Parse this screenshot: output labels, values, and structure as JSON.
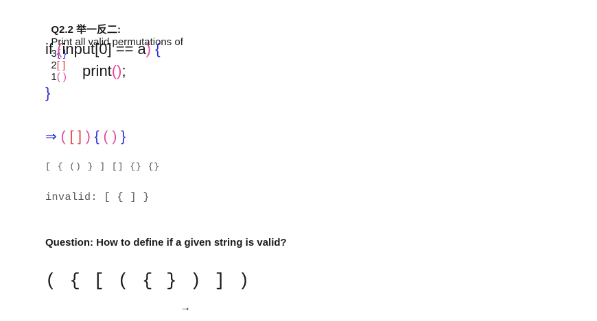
{
  "heading": {
    "qid": "Q2.2 举一反二:",
    "prompt": "Print all valid permutations of",
    "n3": "3",
    "curly": "{ }",
    "n2": "2",
    "square": "[ ]",
    "n1": "1",
    "paren": "( )"
  },
  "code": {
    "kw_if": "if",
    "open_paren": "(",
    "cond_a": "input[0] == a",
    "close_paren": ")",
    "open_brace": "{",
    "call": "print",
    "call_parens": "()",
    "semicolon": ";",
    "close_brace": "}"
  },
  "result": {
    "arrow": "⇒",
    "open_paren": "(",
    "square": "[ ]",
    "close_paren": ")",
    "open_curly": "{",
    "inner_paren": "( )",
    "close_curly": "}"
  },
  "example_line": "[ { () } ] [] {} {}",
  "invalid_line": "invalid: [ { ] }",
  "question": "Question: How to define if a given string is valid?",
  "big_string": "( { [ ( { } ) ] )",
  "small_arrow": "→"
}
